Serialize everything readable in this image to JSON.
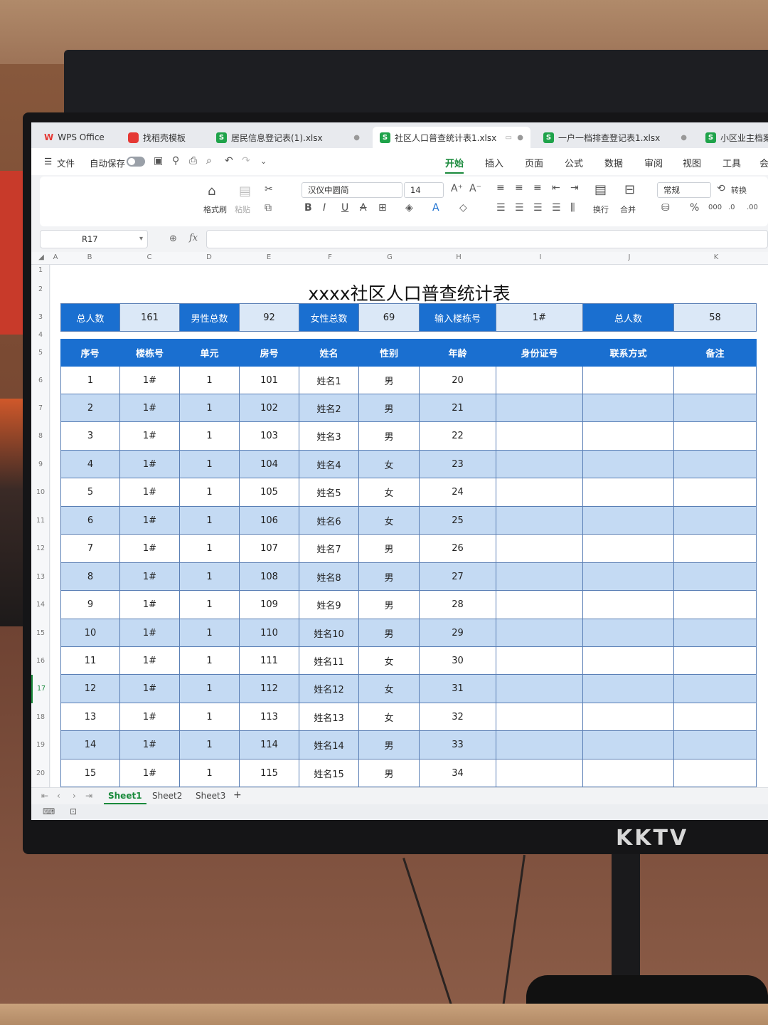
{
  "monitor_brand": "KKTV",
  "tabs": [
    {
      "label": "WPS Office",
      "icon": "wps-logo-icon"
    },
    {
      "label": "找稻壳模板",
      "icon": "docer-icon"
    },
    {
      "label": "居民信息登记表(1).xlsx",
      "icon": "spreadsheet-icon"
    },
    {
      "label": "社区人口普查统计表1.xlsx",
      "icon": "spreadsheet-icon",
      "active": true
    },
    {
      "label": "一户一档排查登记表1.xlsx",
      "icon": "spreadsheet-icon"
    },
    {
      "label": "小区业主档案",
      "icon": "spreadsheet-icon"
    }
  ],
  "menu": {
    "file": "文件",
    "autosave": "自动保存",
    "ribbon_tabs": [
      "开始",
      "插入",
      "页面",
      "公式",
      "数据",
      "审阅",
      "视图",
      "工具",
      "会"
    ]
  },
  "ribbon": {
    "format_painter": "格式刷",
    "paste": "粘贴",
    "font_name": "汉仪中圆简",
    "font_size": "14",
    "wrap": "换行",
    "merge": "合并",
    "number_format": "常规",
    "convert": "转换"
  },
  "formula_bar": {
    "cell_ref": "R17",
    "fx": "fx"
  },
  "columns": [
    "A",
    "B",
    "C",
    "D",
    "E",
    "F",
    "G",
    "H",
    "I",
    "J",
    "K"
  ],
  "row_numbers": [
    "1",
    "2",
    "3",
    "4",
    "5",
    "6",
    "7",
    "8",
    "9",
    "10",
    "11",
    "12",
    "13",
    "14",
    "15",
    "16",
    "17",
    "18",
    "19",
    "20"
  ],
  "active_row": "17",
  "sheet_title": "xxxx社区人口普查统计表",
  "summary": [
    {
      "label": "总人数",
      "value": "161"
    },
    {
      "label": "男性总数",
      "value": "92"
    },
    {
      "label": "女性总数",
      "value": "69"
    },
    {
      "label": "输入楼栋号",
      "value": "1#"
    },
    {
      "label": "总人数",
      "value": "58"
    }
  ],
  "table": {
    "headers": [
      "序号",
      "楼栋号",
      "单元",
      "房号",
      "姓名",
      "性别",
      "年龄",
      "身份证号",
      "联系方式",
      "备注"
    ],
    "rows": [
      [
        "1",
        "1#",
        "1",
        "101",
        "姓名1",
        "男",
        "20",
        "",
        "",
        ""
      ],
      [
        "2",
        "1#",
        "1",
        "102",
        "姓名2",
        "男",
        "21",
        "",
        "",
        ""
      ],
      [
        "3",
        "1#",
        "1",
        "103",
        "姓名3",
        "男",
        "22",
        "",
        "",
        ""
      ],
      [
        "4",
        "1#",
        "1",
        "104",
        "姓名4",
        "女",
        "23",
        "",
        "",
        ""
      ],
      [
        "5",
        "1#",
        "1",
        "105",
        "姓名5",
        "女",
        "24",
        "",
        "",
        ""
      ],
      [
        "6",
        "1#",
        "1",
        "106",
        "姓名6",
        "女",
        "25",
        "",
        "",
        ""
      ],
      [
        "7",
        "1#",
        "1",
        "107",
        "姓名7",
        "男",
        "26",
        "",
        "",
        ""
      ],
      [
        "8",
        "1#",
        "1",
        "108",
        "姓名8",
        "男",
        "27",
        "",
        "",
        ""
      ],
      [
        "9",
        "1#",
        "1",
        "109",
        "姓名9",
        "男",
        "28",
        "",
        "",
        ""
      ],
      [
        "10",
        "1#",
        "1",
        "110",
        "姓名10",
        "男",
        "29",
        "",
        "",
        ""
      ],
      [
        "11",
        "1#",
        "1",
        "111",
        "姓名11",
        "女",
        "30",
        "",
        "",
        ""
      ],
      [
        "12",
        "1#",
        "1",
        "112",
        "姓名12",
        "女",
        "31",
        "",
        "",
        ""
      ],
      [
        "13",
        "1#",
        "1",
        "113",
        "姓名13",
        "女",
        "32",
        "",
        "",
        ""
      ],
      [
        "14",
        "1#",
        "1",
        "114",
        "姓名14",
        "男",
        "33",
        "",
        "",
        ""
      ],
      [
        "15",
        "1#",
        "1",
        "115",
        "姓名15",
        "男",
        "34",
        "",
        "",
        ""
      ]
    ]
  },
  "sheet_tabs": [
    "Sheet1",
    "Sheet2",
    "Sheet3"
  ],
  "active_sheet": "Sheet1",
  "colors": {
    "header_blue": "#1a6fd0",
    "row_light_blue": "#c4daf3",
    "accent_green": "#1a8a3c"
  }
}
